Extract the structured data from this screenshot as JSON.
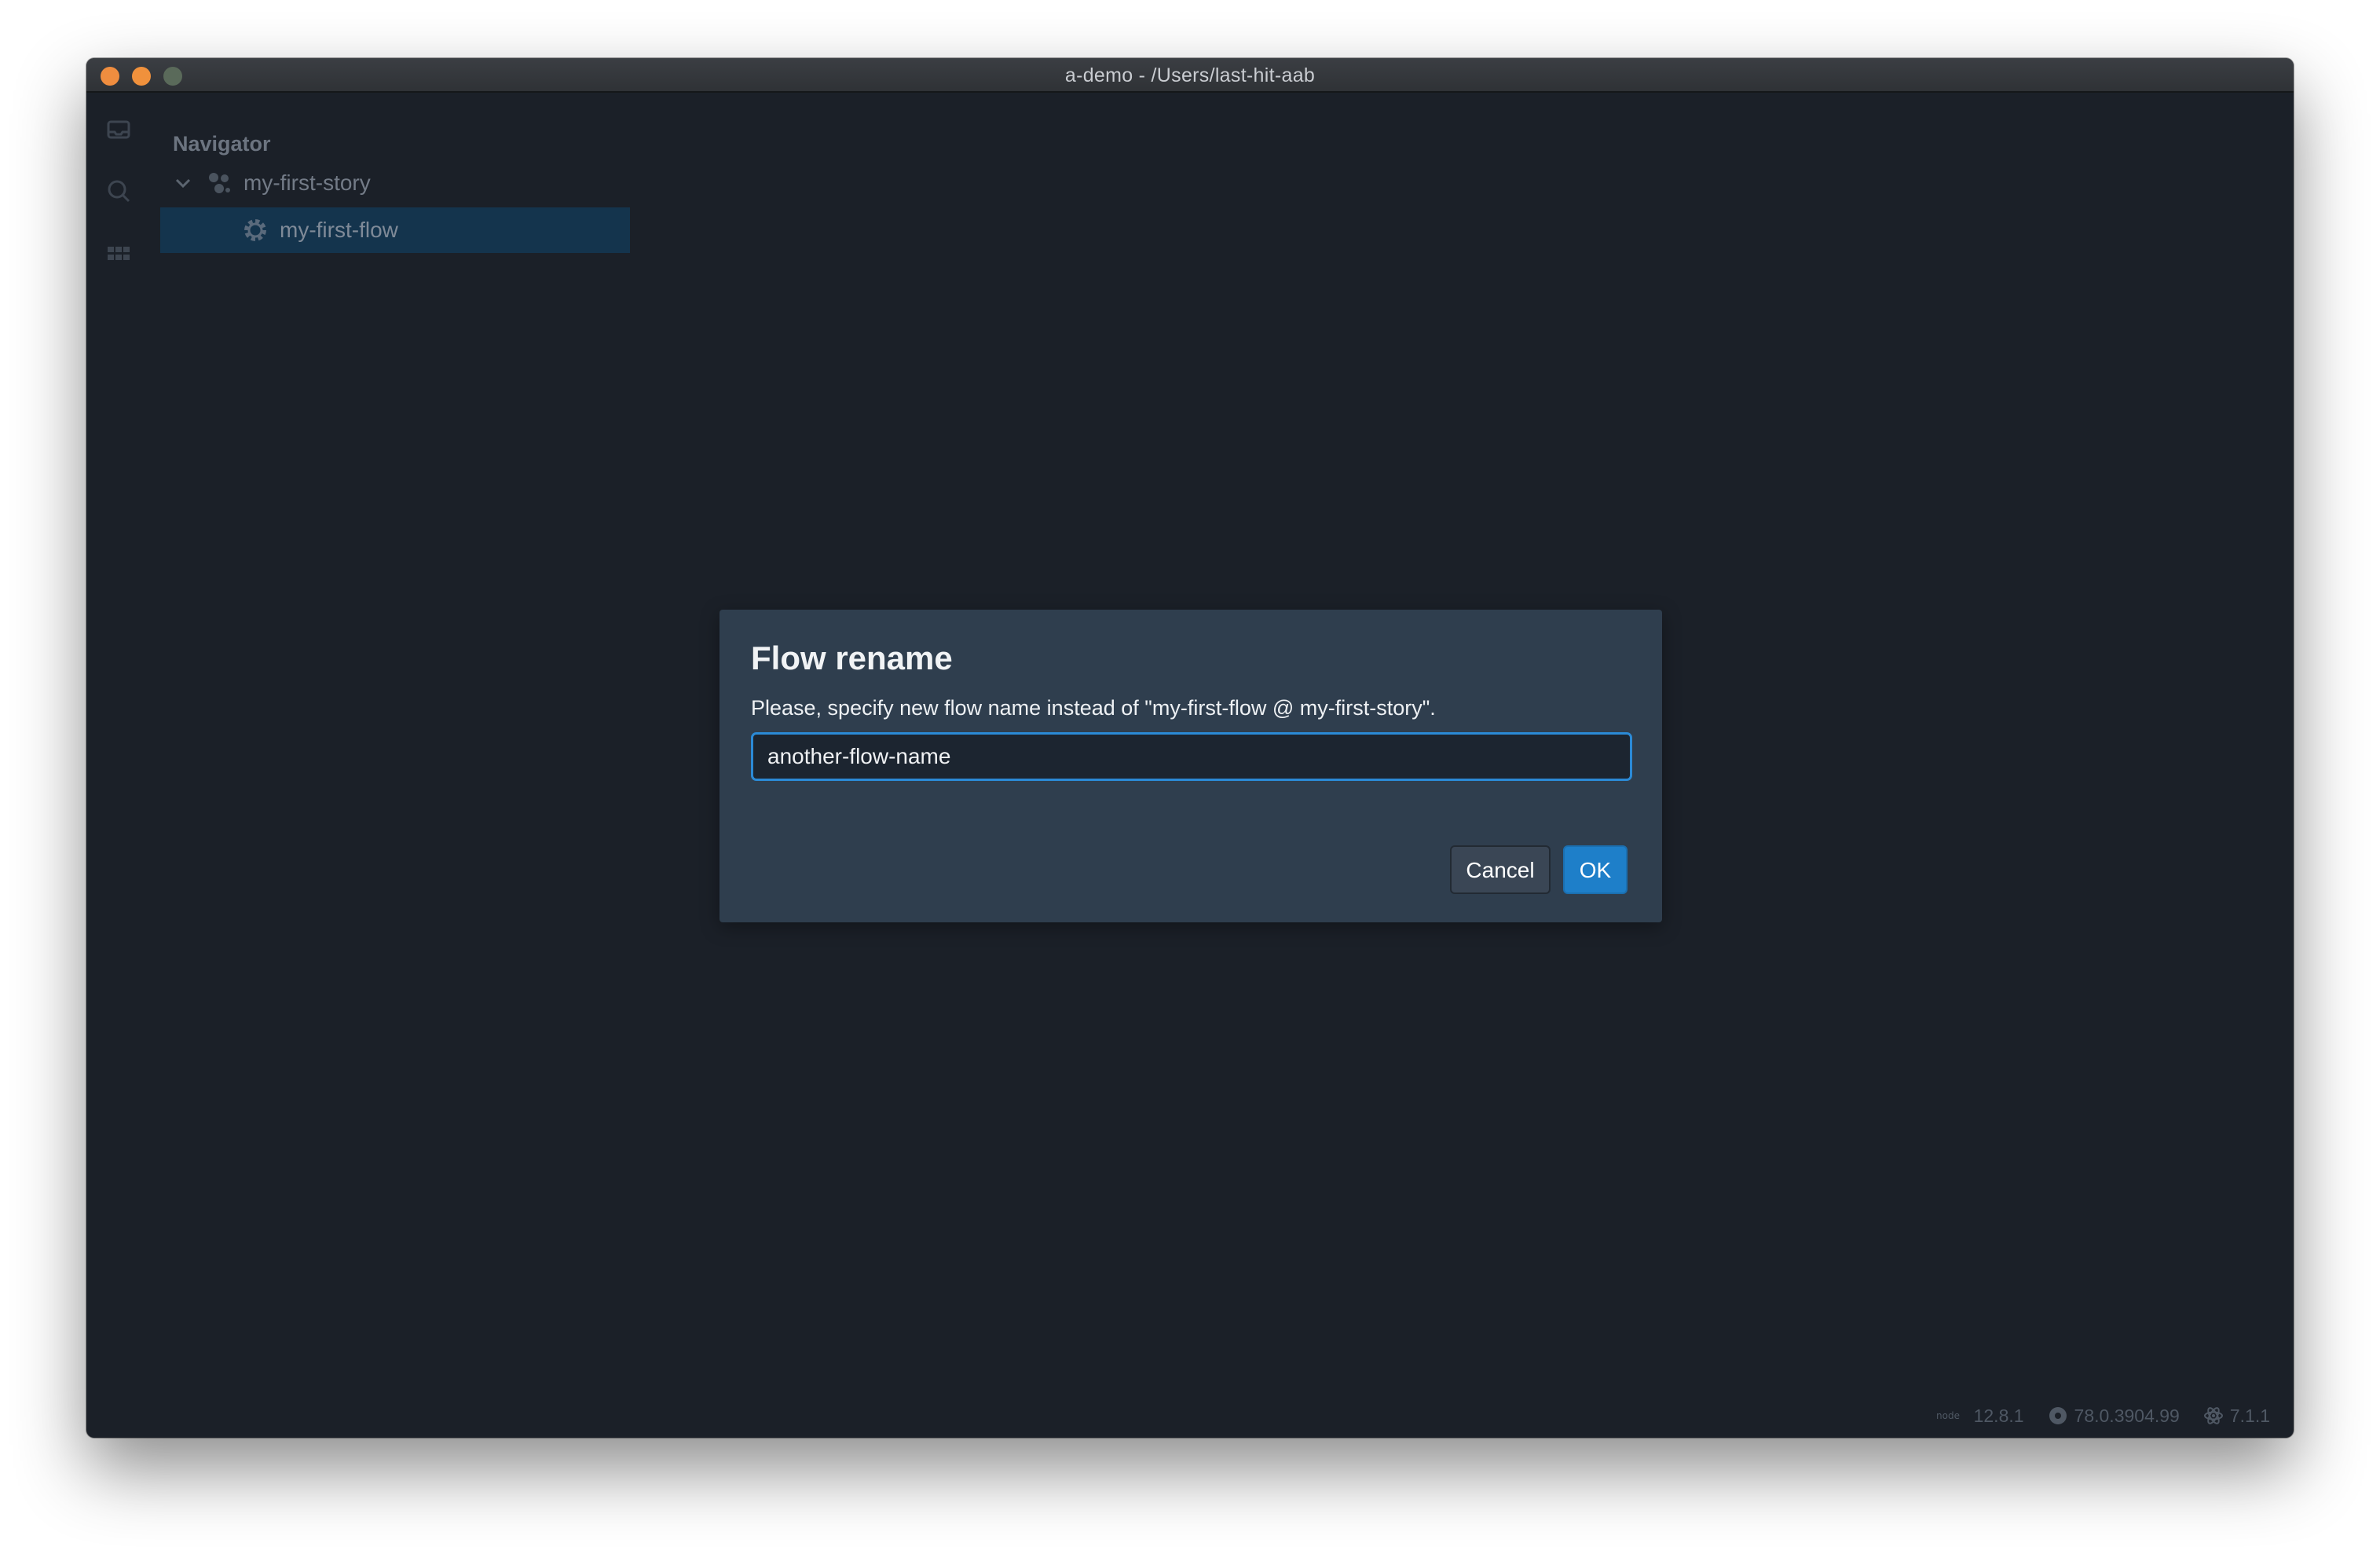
{
  "window": {
    "title": "a-demo - /Users/last-hit-aab"
  },
  "activity_bar": {
    "icons": [
      "inbox-icon",
      "search-icon",
      "grid-icon"
    ]
  },
  "navigator": {
    "title": "Navigator",
    "story": {
      "label": "my-first-story",
      "expanded": true
    },
    "flows": [
      {
        "label": "my-first-flow",
        "selected": true
      }
    ]
  },
  "dialog": {
    "title": "Flow rename",
    "message": "Please, specify new flow name instead of \"my-first-flow @ my-first-story\".",
    "input_value": "another-flow-name",
    "cancel_label": "Cancel",
    "ok_label": "OK"
  },
  "status": {
    "node_version": "12.8.1",
    "chrome_version": "78.0.3904.99",
    "electron_version": "7.1.1"
  },
  "colors": {
    "background": "#1b2028",
    "dialog_background": "#2f3e4e",
    "accent": "#1e7fc9",
    "selection": "#14344d"
  }
}
